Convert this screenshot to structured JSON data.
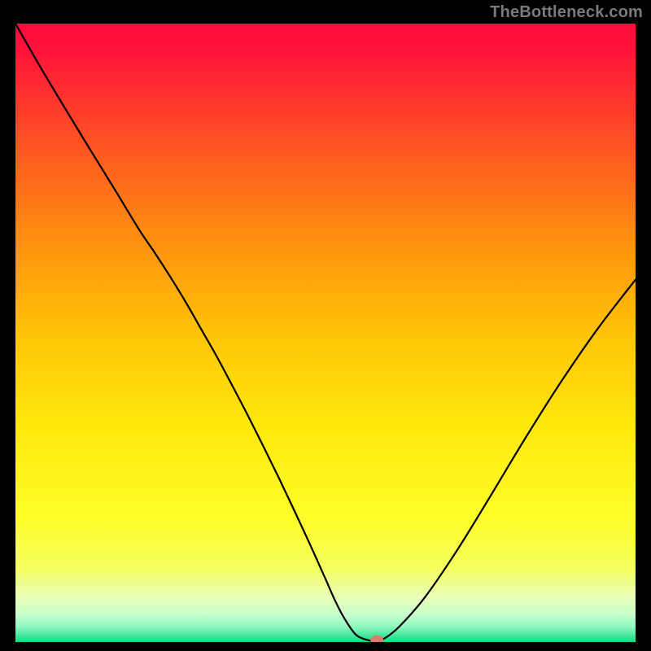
{
  "watermark": {
    "text": "TheBottleneck.com"
  },
  "chart_data": {
    "type": "line",
    "title": "",
    "xlabel": "",
    "ylabel": "",
    "xlim": [
      0,
      100
    ],
    "ylim": [
      0,
      100
    ],
    "grid": false,
    "legend": false,
    "annotations": [],
    "background_gradient_stops": [
      {
        "pos": 0.0,
        "color": "#ff0a3e"
      },
      {
        "pos": 0.045,
        "color": "#ff1339"
      },
      {
        "pos": 0.2,
        "color": "#ff5622"
      },
      {
        "pos": 0.35,
        "color": "#ff8f10"
      },
      {
        "pos": 0.5,
        "color": "#ffc307"
      },
      {
        "pos": 0.65,
        "color": "#ffe80b"
      },
      {
        "pos": 0.8,
        "color": "#fdfe28"
      },
      {
        "pos": 0.88,
        "color": "#f5ff5f"
      },
      {
        "pos": 0.928,
        "color": "#e8ffb8"
      },
      {
        "pos": 0.955,
        "color": "#c9ffcb"
      },
      {
        "pos": 0.975,
        "color": "#90f7c1"
      },
      {
        "pos": 0.988,
        "color": "#4be9a0"
      },
      {
        "pos": 1.0,
        "color": "#17da82"
      }
    ],
    "series": [
      {
        "name": "bottleneck-curve",
        "color": "#000000",
        "x": [
          0.0,
          4.0,
          8.0,
          12.0,
          16.0,
          20.0,
          22.5,
          25.0,
          27.5,
          30.0,
          32.5,
          35.0,
          37.5,
          40.0,
          42.5,
          45.0,
          47.5,
          50.0,
          51.5,
          53.0,
          55.0,
          57.3,
          58.3,
          59.7,
          62.0,
          66.0,
          71.0,
          76.0,
          82.0,
          88.0,
          94.0,
          100.0
        ],
        "y_top100": [
          100.0,
          93.0,
          86.3,
          79.7,
          73.2,
          66.6,
          62.9,
          59.0,
          54.9,
          50.5,
          46.1,
          41.4,
          36.6,
          31.6,
          26.5,
          21.2,
          15.8,
          10.2,
          6.8,
          3.9,
          1.1,
          0.2,
          0.2,
          0.7,
          2.6,
          7.2,
          14.5,
          22.6,
          32.6,
          42.1,
          50.8,
          58.6
        ]
      }
    ],
    "marker": {
      "name": "optimal-point-marker",
      "x": 58.3,
      "y_top100": 0.0,
      "color": "#d87c6c",
      "rx": 8,
      "ry": 6
    }
  }
}
